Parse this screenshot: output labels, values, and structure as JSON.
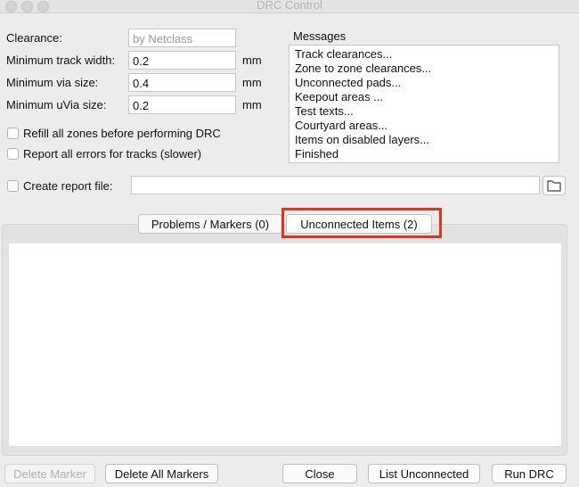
{
  "window": {
    "title": "DRC Control"
  },
  "settings": {
    "clearance": {
      "label": "Clearance:",
      "value": "by Netclass"
    },
    "min_track_width": {
      "label": "Minimum track width:",
      "value": "0.2",
      "unit": "mm"
    },
    "min_via_size": {
      "label": "Minimum via size:",
      "value": "0.4",
      "unit": "mm"
    },
    "min_uvia_size": {
      "label": "Minimum uVia size:",
      "value": "0.2",
      "unit": "mm"
    },
    "refill_zones": {
      "label": "Refill all zones before performing DRC",
      "checked": false
    },
    "report_all_errors": {
      "label": "Report all errors for tracks (slower)",
      "checked": false
    },
    "create_report": {
      "label": "Create report file:",
      "checked": false,
      "value": ""
    }
  },
  "messages": {
    "label": "Messages",
    "lines": [
      "Track clearances...",
      "Zone to zone clearances...",
      "Unconnected pads...",
      "Keepout areas ...",
      "Test texts...",
      "Courtyard areas...",
      "Items on disabled layers...",
      "Finished"
    ]
  },
  "tabs": [
    {
      "label": "Problems / Markers (0)",
      "active": false
    },
    {
      "label": "Unconnected Items (2)",
      "active": true
    }
  ],
  "buttons": {
    "delete_marker": "Delete Marker",
    "delete_all_markers": "Delete All Markers",
    "close": "Close",
    "list_unconnected": "List Unconnected",
    "run_drc": "Run DRC"
  },
  "colors": {
    "highlight": "#e0351c"
  }
}
